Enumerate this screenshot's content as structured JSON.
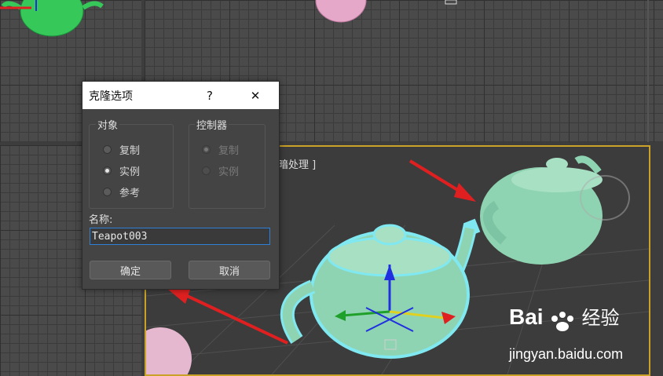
{
  "viewport": {
    "shading_label": "明暗处理 ]"
  },
  "dialog": {
    "title": "克隆选项",
    "help": "?",
    "close": "✕",
    "object_group": {
      "title": "对象",
      "options": [
        {
          "label": "复制",
          "selected": false
        },
        {
          "label": "实例",
          "selected": true
        },
        {
          "label": "参考",
          "selected": false
        }
      ]
    },
    "controller_group": {
      "title": "控制器",
      "options": [
        {
          "label": "复制",
          "selected": true
        },
        {
          "label": "实例",
          "selected": false
        }
      ]
    },
    "name_label": "名称:",
    "name_value": "Teapot003",
    "ok_label": "确定",
    "cancel_label": "取消"
  },
  "watermark": {
    "brand_bai": "Bai",
    "brand_du": "经验",
    "url": "jingyan.baidu.com"
  },
  "colors": {
    "teapot": "#8fd4b2",
    "selection_outline": "#7fe8f0",
    "arrow": "#e02020",
    "sphere": "#e6a8c9"
  }
}
